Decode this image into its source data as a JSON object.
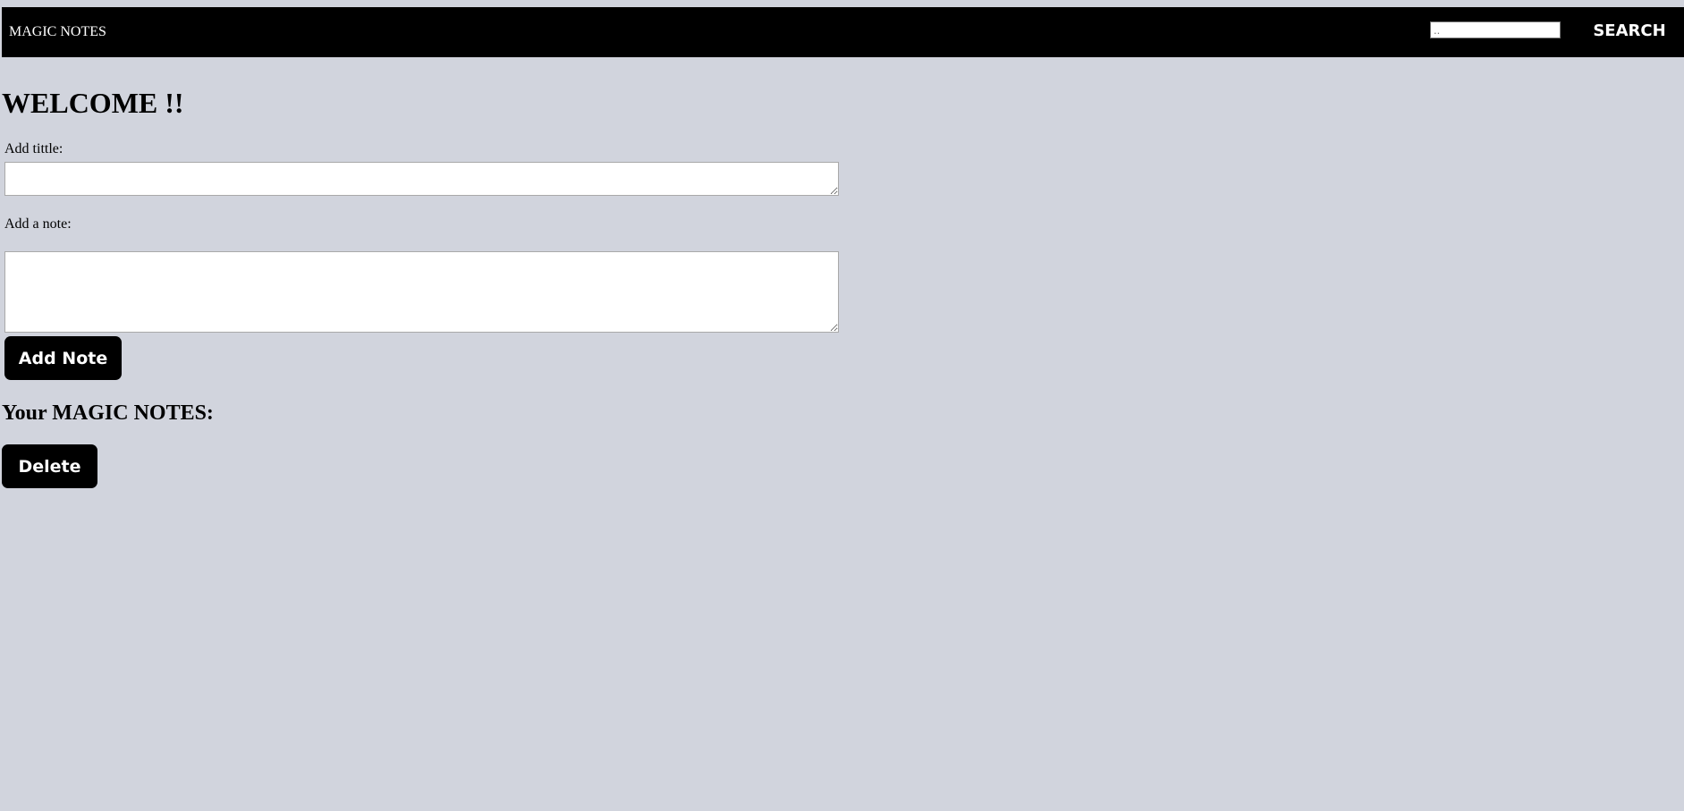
{
  "navbar": {
    "brand": "MAGIC NOTES",
    "search_placeholder": "..",
    "search_value": "",
    "search_button_label": "SEARCH"
  },
  "main": {
    "welcome_heading": "WELCOME !!",
    "title_label": "Add tittle:",
    "title_value": "",
    "note_label": "Add a note:",
    "note_value": "",
    "add_note_button_label": "Add Note",
    "notes_heading": "Your MAGIC NOTES:",
    "delete_button_label": "Delete"
  },
  "colors": {
    "page_background": "#d1d4dd",
    "navbar_background": "#000000",
    "button_background": "#000000",
    "button_text": "#ffffff"
  }
}
